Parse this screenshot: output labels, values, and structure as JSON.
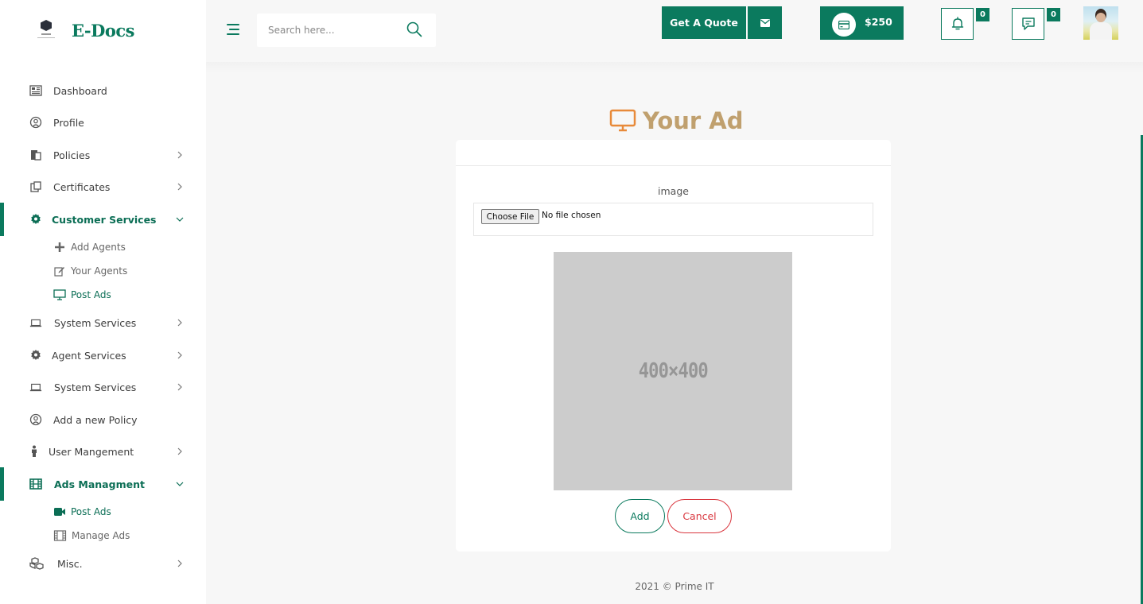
{
  "brand": {
    "name": "E-Docs"
  },
  "sidebar": {
    "items": [
      {
        "label": "Dashboard",
        "icon": "dashboard-icon"
      },
      {
        "label": "Profile",
        "icon": "profile-icon"
      },
      {
        "label": "Policies",
        "icon": "policies-icon"
      },
      {
        "label": "Certificates",
        "icon": "certificates-icon"
      },
      {
        "label": "Customer Services",
        "icon": "gear-icon",
        "expanded": true,
        "children": [
          {
            "label": "Add Agents",
            "icon": "plus-icon"
          },
          {
            "label": "Your Agents",
            "icon": "edit-icon"
          },
          {
            "label": "Post Ads",
            "icon": "monitor-icon",
            "active": true
          }
        ]
      },
      {
        "label": "System Services",
        "icon": "laptop-icon"
      },
      {
        "label": "Agent Services",
        "icon": "gear-icon"
      },
      {
        "label": "System Services",
        "icon": "laptop-icon"
      },
      {
        "label": "Add a new Policy",
        "icon": "profile-icon"
      },
      {
        "label": "User Mangement",
        "icon": "person-icon"
      },
      {
        "label": "Ads Managment",
        "icon": "film-icon",
        "expanded": true,
        "children": [
          {
            "label": "Post Ads",
            "icon": "video-icon"
          },
          {
            "label": "Manage Ads",
            "icon": "film-icon"
          }
        ]
      },
      {
        "label": "Misc.",
        "icon": "cubes-icon"
      }
    ]
  },
  "topbar": {
    "search_placeholder": "Search here...",
    "quote_label": "Get A Quote",
    "wallet_amount": "$250",
    "notifications_count": "0",
    "messages_count": "0"
  },
  "page": {
    "title": "Your Ad",
    "field_label": "image",
    "file_button": "Choose File",
    "file_status": "No file chosen",
    "placeholder_text": "400×400",
    "add_label": "Add",
    "cancel_label": "Cancel"
  },
  "footer": {
    "text": "2021 © Prime IT"
  },
  "colors": {
    "primary": "#0b7a5e",
    "title": "#c0a06e",
    "title_icon": "#e88a3a",
    "danger": "#d9363e"
  }
}
